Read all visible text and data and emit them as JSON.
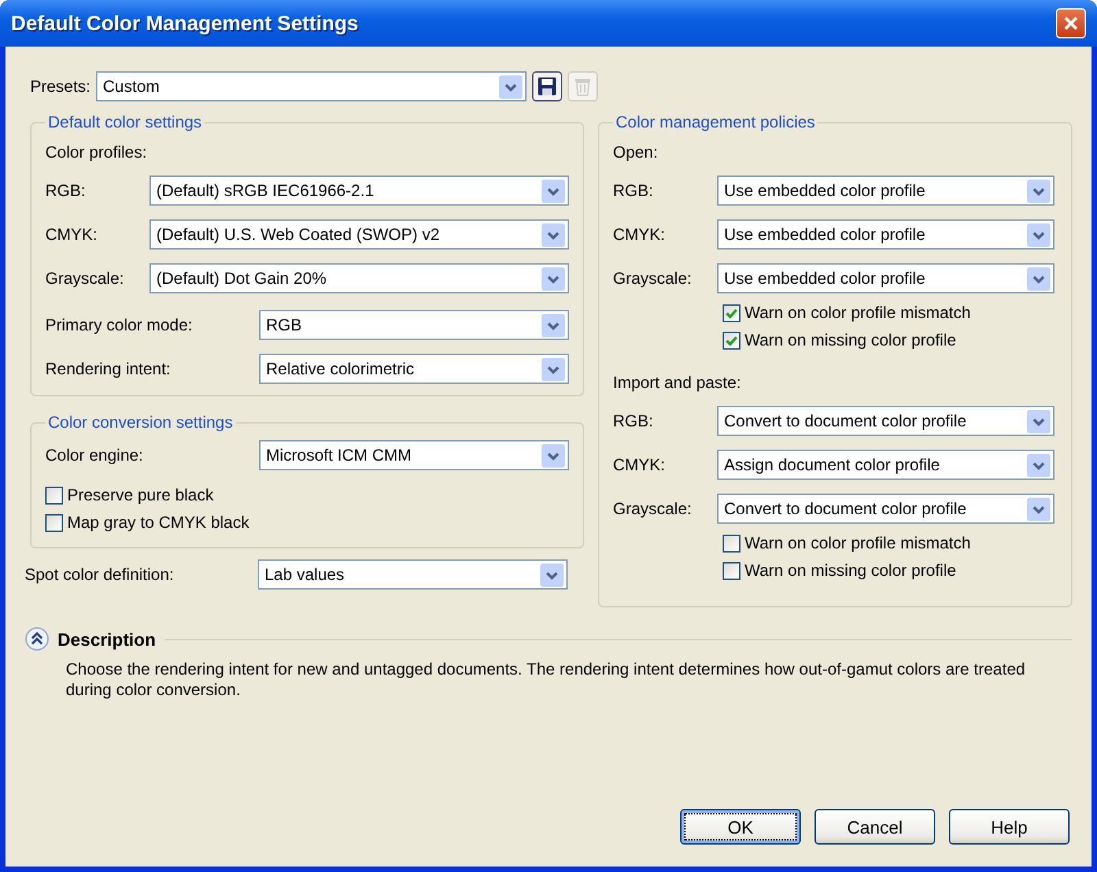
{
  "window": {
    "title": "Default Color Management Settings"
  },
  "presets": {
    "label": "Presets:",
    "value": "Custom",
    "tools": [
      {
        "kind": "save",
        "disabled": false
      },
      {
        "kind": "delete",
        "disabled": true
      }
    ]
  },
  "default_color_settings": {
    "title": "Default color settings",
    "subheading": "Color profiles:",
    "profiles": [
      {
        "label": "RGB:",
        "value": "(Default) sRGB IEC61966-2.1"
      },
      {
        "label": "CMYK:",
        "value": "(Default) U.S. Web Coated (SWOP) v2"
      },
      {
        "label": "Grayscale:",
        "value": "(Default) Dot Gain 20%"
      }
    ],
    "modes": [
      {
        "label": "Primary color mode:",
        "value": "RGB"
      },
      {
        "label": "Rendering intent:",
        "value": "Relative colorimetric"
      }
    ]
  },
  "color_conversion_settings": {
    "title": "Color conversion settings",
    "engine": {
      "label": "Color engine:",
      "value": "Microsoft ICM CMM"
    },
    "options": [
      {
        "label": "Preserve pure black",
        "checked": false
      },
      {
        "label": "Map gray to CMYK black",
        "checked": false
      }
    ]
  },
  "spot_color_definition": {
    "label": "Spot color definition:",
    "value": "Lab values"
  },
  "color_management_policies": {
    "title": "Color management policies",
    "sections": [
      {
        "heading": "Open:",
        "rows": [
          {
            "label": "RGB:",
            "value": "Use embedded color profile"
          },
          {
            "label": "CMYK:",
            "value": "Use embedded color profile"
          },
          {
            "label": "Grayscale:",
            "value": "Use embedded color profile"
          }
        ],
        "options": [
          {
            "label": "Warn on color profile mismatch",
            "checked": true
          },
          {
            "label": "Warn on missing color profile",
            "checked": true
          }
        ]
      },
      {
        "heading": "Import and paste:",
        "rows": [
          {
            "label": "RGB:",
            "value": "Convert to document color profile"
          },
          {
            "label": "CMYK:",
            "value": "Assign document color profile"
          },
          {
            "label": "Grayscale:",
            "value": "Convert to document color profile"
          }
        ],
        "options": [
          {
            "label": "Warn on color profile mismatch",
            "checked": false
          },
          {
            "label": "Warn on missing color profile",
            "checked": false
          }
        ]
      }
    ]
  },
  "description": {
    "title": "Description",
    "text": "Choose the rendering intent for new and untagged documents. The rendering intent determines how out-of-gamut colors are treated during color conversion."
  },
  "buttons": [
    {
      "label": "OK",
      "default": true
    },
    {
      "label": "Cancel",
      "default": false
    },
    {
      "label": "Help",
      "default": false
    }
  ]
}
